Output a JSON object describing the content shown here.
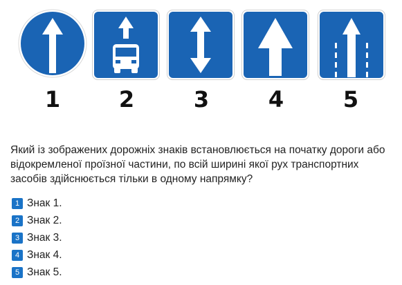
{
  "signs": [
    {
      "number": "1",
      "icon": "round-one-way-arrow-up-icon"
    },
    {
      "number": "2",
      "icon": "bus-lane-arrow-up-icon"
    },
    {
      "number": "3",
      "icon": "double-arrow-up-down-icon"
    },
    {
      "number": "4",
      "icon": "one-way-road-arrow-icon"
    },
    {
      "number": "5",
      "icon": "lanes-one-direction-arrow-icon"
    }
  ],
  "colors": {
    "sign_blue": "#1a64b4",
    "answer_badge": "#1a73c7"
  },
  "question": "Який із зображених дорожніх знаків встановлюється на початку дороги або відокремленої проїзної частини, по всій ширині якої рух транспортних засобів здійснюється тільки в одному напрямку?",
  "answers": [
    {
      "badge": "1",
      "label": "Знак 1."
    },
    {
      "badge": "2",
      "label": "Знак 2."
    },
    {
      "badge": "3",
      "label": "Знак 3."
    },
    {
      "badge": "4",
      "label": "Знак 4."
    },
    {
      "badge": "5",
      "label": "Знак 5."
    }
  ]
}
